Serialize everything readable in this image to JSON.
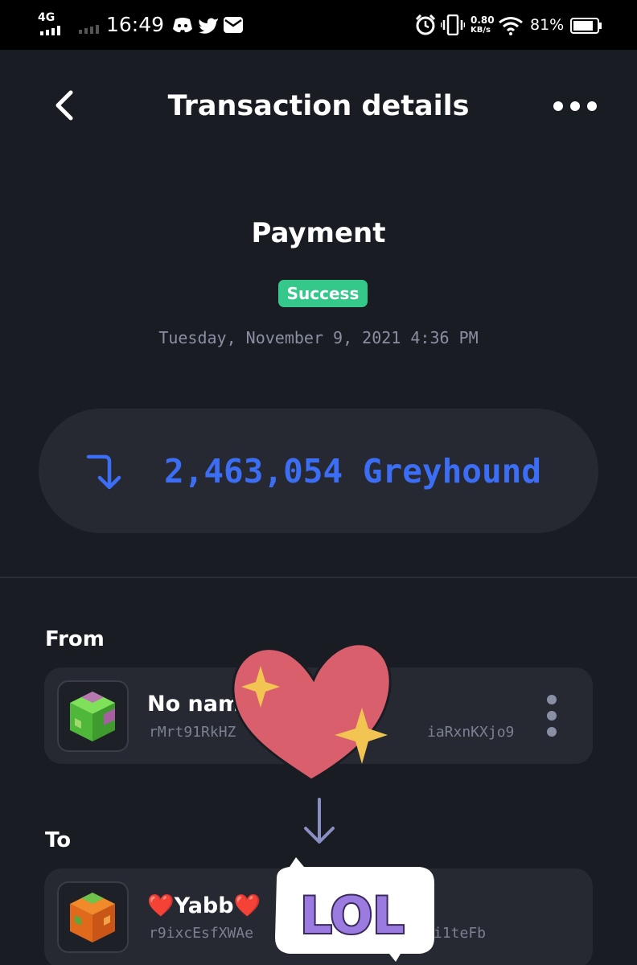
{
  "status_bar": {
    "network": "4G",
    "time": "16:49",
    "speed_value": "0.80",
    "speed_unit": "KB/s",
    "battery": "81%"
  },
  "header": {
    "title": "Transaction details"
  },
  "transaction": {
    "type": "Payment",
    "status": "Success",
    "date": "Tuesday, November 9, 2021 4:36 PM",
    "amount": "2,463,054 Greyhound"
  },
  "from": {
    "label": "From",
    "name": "No name",
    "address_start": "rMrt91RkHZ",
    "address_end": "iaRxnKXjo9"
  },
  "to": {
    "label": "To",
    "name": "❤️Yabb❤️",
    "address_start": "r9ixcEsfXWAe",
    "address_end": "i1teFb"
  },
  "stickers": {
    "lol_text": "LOL"
  },
  "colors": {
    "background": "#1a1c23",
    "card": "#262931",
    "accent": "#3b6ef5",
    "success": "#34c88b",
    "muted_text": "#8a8fa3"
  },
  "icons": {
    "back": "chevron-left-icon",
    "more": "more-horizontal-icon",
    "amount": "incoming-arrow-icon",
    "account_menu": "more-vertical-icon",
    "flow": "arrow-down-icon"
  }
}
